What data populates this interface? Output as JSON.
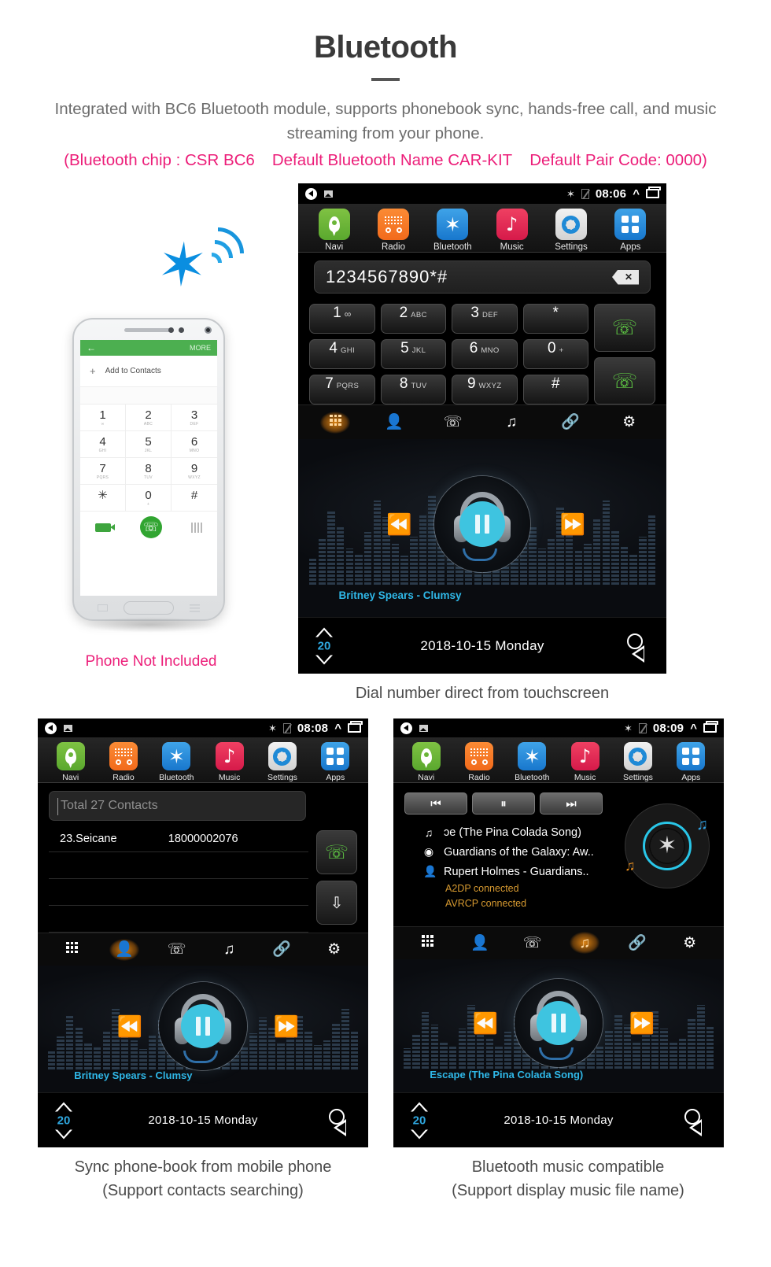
{
  "header": {
    "title": "Bluetooth",
    "subtitle": "Integrated with BC6 Bluetooth module, supports phonebook sync, hands-free call, and music streaming from your phone.",
    "spec_chip": "(Bluetooth chip : CSR BC6",
    "spec_name": "Default Bluetooth Name CAR-KIT",
    "spec_code": "Default Pair Code: 0000)",
    "accent_pink": "#ec1e79"
  },
  "phone_mockup": {
    "statusbar_more": "MORE",
    "add_to_contacts": "Add to Contacts",
    "keys": [
      {
        "digit": "1",
        "sub": "∞"
      },
      {
        "digit": "2",
        "sub": "ABC"
      },
      {
        "digit": "3",
        "sub": "DEF"
      },
      {
        "digit": "4",
        "sub": "GHI"
      },
      {
        "digit": "5",
        "sub": "JKL"
      },
      {
        "digit": "6",
        "sub": "MNO"
      },
      {
        "digit": "7",
        "sub": "PQRS"
      },
      {
        "digit": "8",
        "sub": "TUV"
      },
      {
        "digit": "9",
        "sub": "WXYZ"
      },
      {
        "digit": "✳",
        "sub": ""
      },
      {
        "digit": "0",
        "sub": "+"
      },
      {
        "digit": "#",
        "sub": ""
      }
    ],
    "not_included_label": "Phone Not Included"
  },
  "launcher": {
    "apps": [
      {
        "label": "Navi",
        "icon": "map-pin-icon"
      },
      {
        "label": "Radio",
        "icon": "radio-icon"
      },
      {
        "label": "Bluetooth",
        "icon": "bluetooth-icon"
      },
      {
        "label": "Music",
        "icon": "music-note-icon"
      },
      {
        "label": "Settings",
        "icon": "gear-icon"
      },
      {
        "label": "Apps",
        "icon": "grid-apps-icon"
      }
    ]
  },
  "main_screen": {
    "status": {
      "time": "08:06",
      "bluetooth": "✶",
      "volume_icon": "volume-icon",
      "recent_icon": "recent-apps-icon"
    },
    "dialed_number": "1234567890*#",
    "keypad": [
      {
        "digit": "1",
        "sub": "∞"
      },
      {
        "digit": "2",
        "sub": "ABC"
      },
      {
        "digit": "3",
        "sub": "DEF"
      },
      {
        "digit": "*",
        "sub": ""
      },
      {
        "digit": "4",
        "sub": "GHI"
      },
      {
        "digit": "5",
        "sub": "JKL"
      },
      {
        "digit": "6",
        "sub": "MNO"
      },
      {
        "digit": "0",
        "sub": "+"
      },
      {
        "digit": "7",
        "sub": "PQRS"
      },
      {
        "digit": "8",
        "sub": "TUV"
      },
      {
        "digit": "9",
        "sub": "WXYZ"
      },
      {
        "digit": "#",
        "sub": ""
      }
    ],
    "tabs": [
      {
        "name": "keypad",
        "active": true
      },
      {
        "name": "contacts",
        "active": false
      },
      {
        "name": "call-history",
        "active": false
      },
      {
        "name": "bluetooth-music",
        "active": false
      },
      {
        "name": "pair-link",
        "active": false
      },
      {
        "name": "settings",
        "active": false
      }
    ],
    "player": {
      "track": "Britney Spears - Clumsy",
      "state": "playing"
    },
    "bottom": {
      "volume": "20",
      "date": "2018-10-15  Monday"
    },
    "caption": "Dial number direct from touchscreen"
  },
  "contacts_screen": {
    "status": {
      "time": "08:08"
    },
    "search_placeholder": "Total 27 Contacts",
    "columns": [
      "name",
      "number"
    ],
    "rows": [
      {
        "name": "23.Seicane",
        "number": "18000002076"
      }
    ],
    "call_button_icon": "call-icon",
    "download_button_icon": "download-contacts-icon",
    "tabs_active": "contacts",
    "player": {
      "track": "Britney Spears - Clumsy",
      "state": "playing"
    },
    "bottom": {
      "volume": "20",
      "date": "2018-10-15  Monday"
    },
    "caption_line1": "Sync phone-book from mobile phone",
    "caption_line2": "(Support contacts searching)"
  },
  "btmusic_screen": {
    "status": {
      "time": "08:09"
    },
    "transport": [
      {
        "name": "previous",
        "glyph": "⏮"
      },
      {
        "name": "pause",
        "glyph": "⏸"
      },
      {
        "name": "next",
        "glyph": "⏭"
      }
    ],
    "meta": [
      {
        "icon": "music-note-icon",
        "text": "ɔe (The Pina Colada Song)"
      },
      {
        "icon": "album-icon",
        "text": "Guardians of the Galaxy: Aw.."
      },
      {
        "icon": "artist-icon",
        "text": "Rupert Holmes - Guardians.."
      }
    ],
    "status_lines": [
      "A2DP  connected",
      "AVRCP  connected"
    ],
    "tabs_active": "bluetooth-music",
    "player": {
      "track": "Escape (The Pina Colada Song)",
      "state": "playing"
    },
    "bottom": {
      "volume": "20",
      "date": "2018-10-15  Monday"
    },
    "caption_line1": "Bluetooth music compatible",
    "caption_line2": "(Support display music file name)"
  }
}
